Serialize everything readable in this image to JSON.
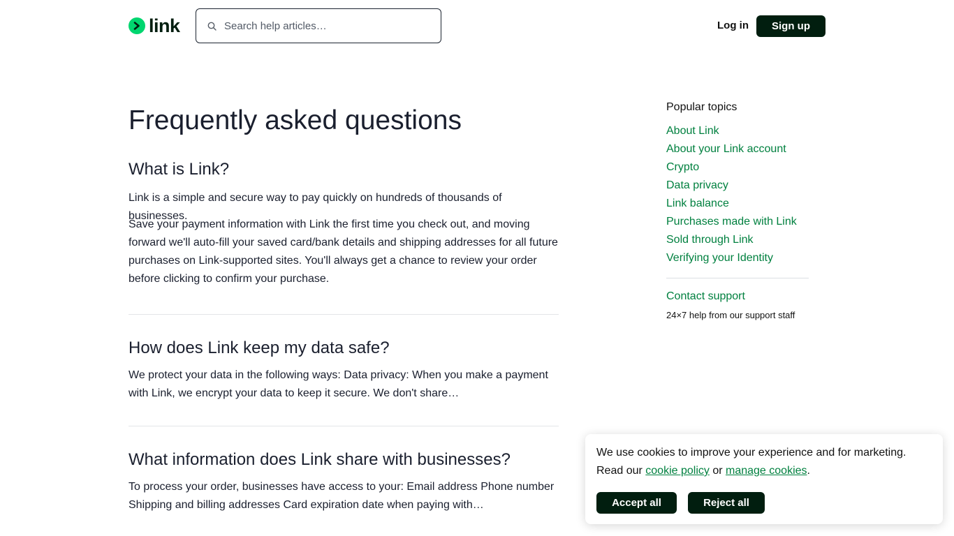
{
  "header": {
    "logo_text": "link",
    "search_placeholder": "Search help articles…",
    "login_label": "Log in",
    "signup_label": "Sign up"
  },
  "main": {
    "title": "Frequently asked questions",
    "questions": [
      {
        "title": "What is Link?",
        "paragraphs": [
          "Link is a simple and secure way to pay quickly on hundreds of thousands of businesses.",
          "Save your payment information with Link the first time you check out, and moving forward we'll auto-fill your saved card/bank details and shipping addresses for all future purchases on Link-supported sites. You'll always get a chance to review your order before clicking to confirm your purchase."
        ]
      },
      {
        "title": "How does Link keep my data safe?",
        "paragraphs": [
          "We protect your data in the following ways: Data privacy: When you make a payment with Link, we encrypt your data to keep it secure. We don't share…"
        ]
      },
      {
        "title": "What information does Link share with businesses?",
        "paragraphs": [
          "To process your order, businesses have access to your: Email address Phone number Shipping and billing addresses Card expiration date when paying with…"
        ]
      }
    ]
  },
  "sidebar": {
    "heading": "Popular topics",
    "topics": [
      "About Link",
      "About your Link account",
      "Crypto",
      "Data privacy",
      "Link balance",
      "Purchases made with Link",
      "Sold through Link",
      "Verifying your Identity"
    ],
    "contact_label": "Contact support",
    "contact_sub": "24×7 help from our support staff"
  },
  "cookie_banner": {
    "text_1": "We use cookies to improve your experience and for marketing. Read our ",
    "cookie_policy_link": "cookie policy",
    "text_2": " or ",
    "manage_link": "manage cookies",
    "text_3": ".",
    "accept_label": "Accept all",
    "reject_label": "Reject all"
  },
  "colors": {
    "brand_green": "#00d66f",
    "link_green": "#00803f",
    "dark_button": "#011e0f",
    "text": "#1a1f2e"
  },
  "icons": [
    "search-icon",
    "link-logo-arrow-icon"
  ]
}
